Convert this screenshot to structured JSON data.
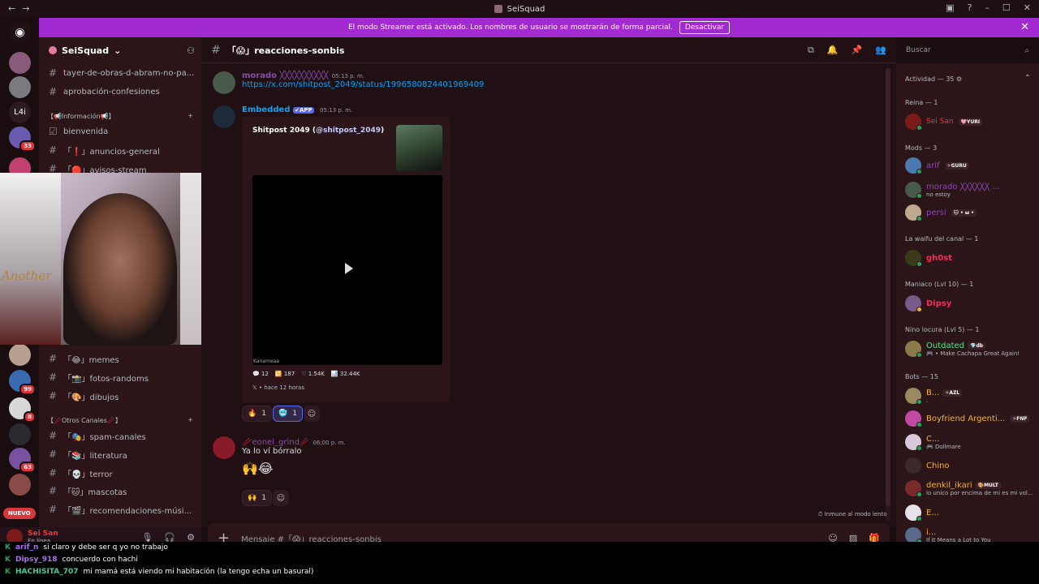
{
  "titlebar": {
    "title": "SeiSquad"
  },
  "banner": {
    "text": "El modo Streamer está activado. Los nombres de usuario se mostrarán de forma parcial.",
    "button": "Desactivar"
  },
  "servers": {
    "badges": [
      "33",
      "99",
      "8",
      "63"
    ],
    "text_server": "L4i",
    "nuevo": "NUEVO"
  },
  "sidebar": {
    "server_name": "SeiSquad",
    "channels_top": [
      "tayer-de-obras-d-abram-no-pa...",
      "aprobación-confesiones"
    ],
    "cat_info": "【📢Información📢】",
    "channels_info": [
      "bienvenida",
      "「❗」anuncios-general",
      "「🔴」avisos-stream"
    ],
    "channels_mid": [
      "「😂」memes",
      "「📸」fotos-randoms",
      "「🎨」dibujos"
    ],
    "cat_otros": "【🥢Otros Canales🥢】",
    "channels_otros": [
      "「🎭」spam-canales",
      "「📚」literatura",
      "「💀」terror",
      "「🐱」mascotas",
      "「🎬」recomendaciones-músi..."
    ]
  },
  "user": {
    "name": "Sei San",
    "status": "En línea"
  },
  "channel": {
    "name": "「😱」reacciones-sonbis"
  },
  "search": {
    "placeholder": "Buscar"
  },
  "messages": {
    "m1": {
      "user": "morado ╳╳╳╳╳╳╳╳╳╳",
      "time": "05:13 p. m.",
      "text": "https://x.com/shitpost_2049/status/1996580824401969409"
    },
    "m2": {
      "user": "Embedded",
      "bot_tag": "✔APP",
      "time": "05:13 p. m.",
      "embed_title": "Shitpost 2049 (",
      "embed_handle": "@shitpost_2049",
      "embed_close": ")",
      "video_label": "Kanameaa",
      "replies": "12",
      "reposts": "187",
      "likes": "1.54K",
      "views": "32.44K",
      "footer": "hace 12 horas",
      "react1": "1",
      "react2": "1"
    },
    "m3": {
      "user": "🥢eonel_grind🥢",
      "time": "06:00 p. m.",
      "text": "Ya lo ví bórralo",
      "emoji": "🙌😂",
      "react": "1"
    }
  },
  "slow_mode": "Inmune al modo lento",
  "input": {
    "placeholder": "Mensaje #「😱」reacciones-sonbis"
  },
  "members": {
    "activity": "Actividad — 35 ⚙",
    "groups": [
      {
        "title": "Reina — 1"
      },
      {
        "title": "Mods — 3"
      },
      {
        "title": "La waifu del canal — 1"
      },
      {
        "title": "Maniaco (Lvl 10) — 1"
      },
      {
        "title": "Nino locura (Lvl 5) — 1"
      },
      {
        "title": "Bots — 15"
      }
    ],
    "list": [
      {
        "name": "Sei San",
        "tag": "🩷YURI",
        "sub": ""
      },
      {
        "name": "arif",
        "tag": "✧GURU",
        "sub": ""
      },
      {
        "name": "morado ╳╳╳╳╳╳ ...",
        "tag": "",
        "sub": "no estoy"
      },
      {
        "name": "persi",
        "tag": "🐱 • ω •",
        "sub": ""
      },
      {
        "name": "gh0st",
        "tag": "",
        "sub": ""
      },
      {
        "name": "Dipsy",
        "tag": "",
        "sub": ""
      },
      {
        "name": "Outdated",
        "tag": "💎db",
        "sub": "🎮 • Make Cachapa Great Again!"
      },
      {
        "name": "B...",
        "tag": "✧AZL",
        "sub": "."
      },
      {
        "name": "Boyfriend Argenti...",
        "tag": "✧FNF",
        "sub": ""
      },
      {
        "name": "C...",
        "tag": "",
        "sub": "🎮 Dollmare"
      },
      {
        "name": "Chino",
        "tag": "",
        "sub": ""
      },
      {
        "name": "denkil_ikari",
        "tag": "🎨MULT",
        "sub": "lo unico por encima de mi es mi vol..."
      },
      {
        "name": "E...",
        "tag": "",
        "sub": ""
      },
      {
        "name": "i...",
        "tag": "",
        "sub": "If It Means a Lot to You"
      }
    ]
  },
  "twitch_chat": [
    {
      "user": "arif_n",
      "text": "si claro y debe ser q yo no trabajo"
    },
    {
      "user": "Dipsy_918",
      "text": "concuerdo con hachi"
    },
    {
      "user": "HACHISITA_707",
      "text": "mi mamá está viendo mi habitación (la tengo echa un basural)"
    }
  ]
}
